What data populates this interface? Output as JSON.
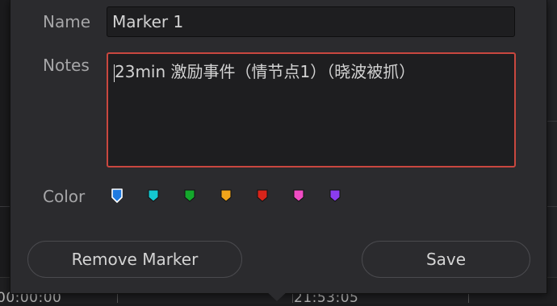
{
  "dialog": {
    "name_label": "Name",
    "name_value": "Marker 1",
    "notes_label": "Notes",
    "notes_value": "23min 激励事件（情节点1）（晓波被抓）",
    "color_label": "Color",
    "colors": [
      {
        "name": "blue",
        "hex": "#1f7ae0"
      },
      {
        "name": "cyan",
        "hex": "#14c8d0"
      },
      {
        "name": "green",
        "hex": "#14a82c"
      },
      {
        "name": "yellow",
        "hex": "#f0a41a"
      },
      {
        "name": "red",
        "hex": "#d8241a"
      },
      {
        "name": "pink",
        "hex": "#f04cc4"
      },
      {
        "name": "purple",
        "hex": "#8a3cf0"
      }
    ],
    "selected_color": "blue",
    "remove_button_label": "Remove Marker",
    "save_button_label": "Save",
    "accent_focus_color": "#c9473f"
  },
  "timeline": {
    "timecode_left": "00:00:00",
    "timecode_right": "21:53:05"
  }
}
